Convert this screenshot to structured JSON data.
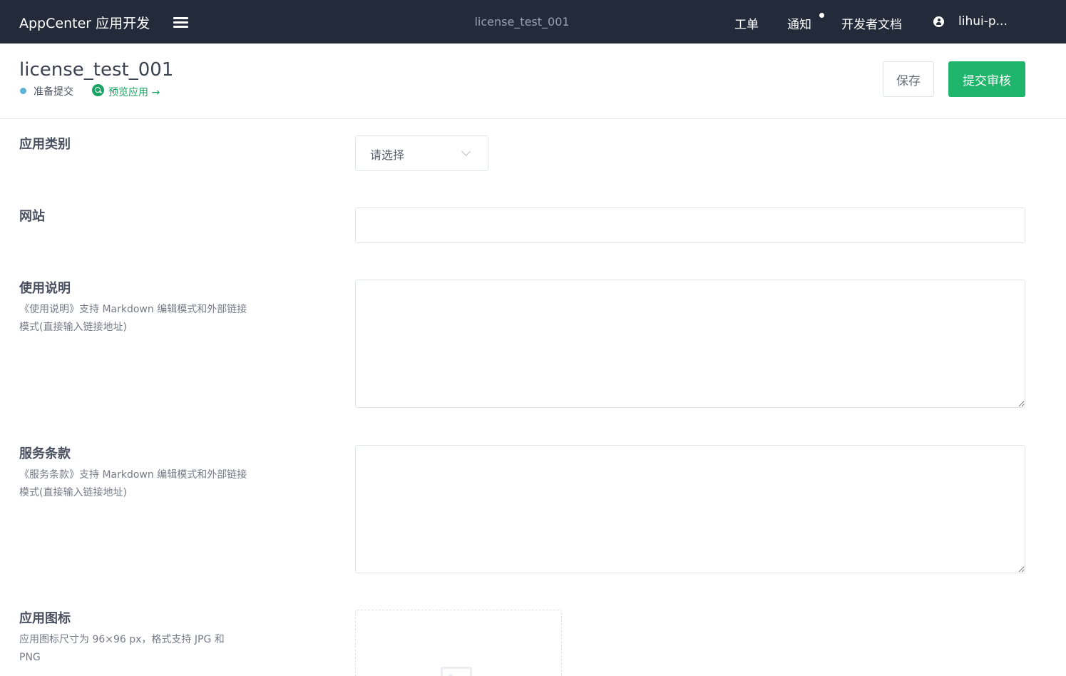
{
  "navbar": {
    "brand": "AppCenter 应用开发",
    "center_title": "license_test_001",
    "links": {
      "tickets": "工单",
      "notifications": "通知",
      "dev_docs": "开发者文档"
    },
    "user": "lihui-p..."
  },
  "header": {
    "title": "license_test_001",
    "status": "准备提交",
    "preview_link": "预览应用 →",
    "save_label": "保存",
    "submit_label": "提交审核"
  },
  "form": {
    "category": {
      "label": "应用类别",
      "placeholder": "请选择"
    },
    "website": {
      "label": "网站",
      "value": ""
    },
    "usage": {
      "label": "使用说明",
      "help": "《使用说明》支持 Markdown 编辑模式和外部链接模式(直接输入链接地址)",
      "value": ""
    },
    "terms": {
      "label": "服务条款",
      "help": "《服务条款》支持 Markdown 编辑模式和外部链接模式(直接输入链接地址)",
      "value": ""
    },
    "icon": {
      "label": "应用图标",
      "help": "应用图标尺寸为 96×96 px，格式支持 JPG 和 PNG"
    }
  },
  "colors": {
    "navbar_bg": "#232a3a",
    "accent_green": "#1fb56b",
    "status_dot": "#5fb3d6"
  },
  "icons": [
    "menu-icon",
    "user-icon",
    "search-icon",
    "chevron-down-icon",
    "image-icon"
  ]
}
